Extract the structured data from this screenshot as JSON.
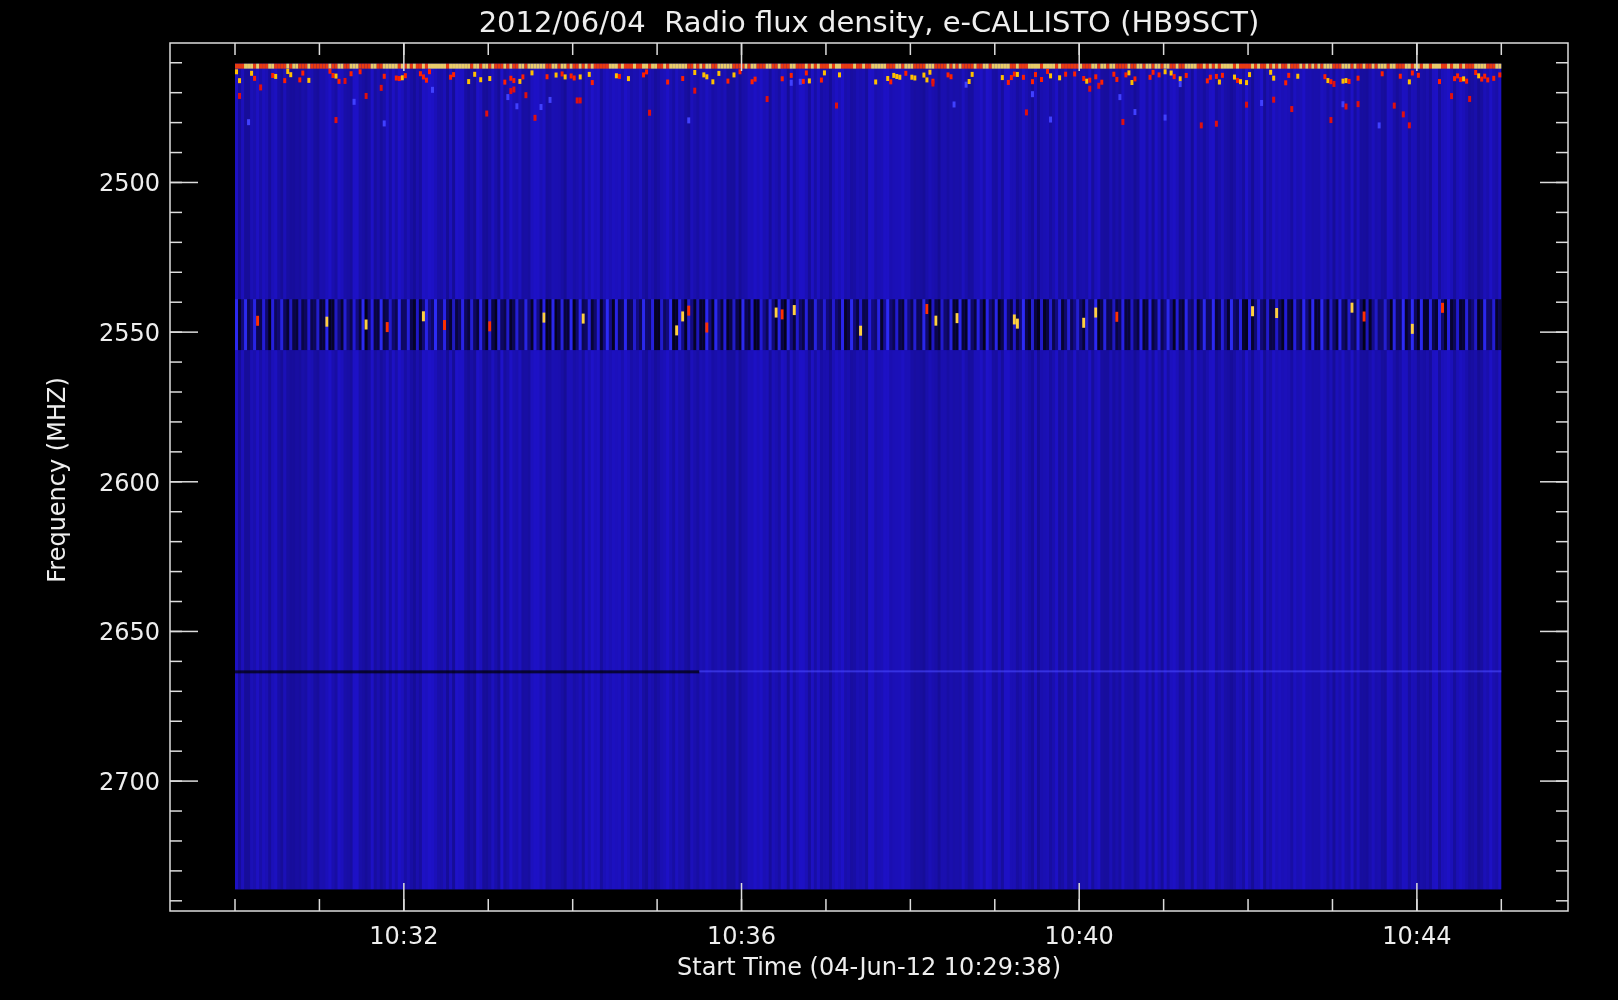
{
  "title": "2012/06/04  Radio flux density, e-CALLISTO (HB9SCT)",
  "y_axis": {
    "label": "Frequency (MHZ)",
    "ticks": [
      "2500",
      "2550",
      "2600",
      "2650",
      "2700"
    ]
  },
  "x_axis": {
    "label": "Start Time (04-Jun-12 10:29:38)",
    "ticks": [
      "10:32",
      "10:36",
      "10:40",
      "10:44"
    ]
  }
}
